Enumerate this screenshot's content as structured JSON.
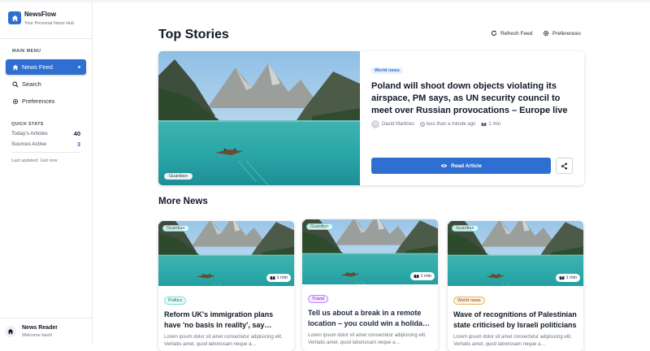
{
  "app": {
    "name": "NewsFlow",
    "tagline": "Your Personal News Hub"
  },
  "sidebar": {
    "menu_label": "MAIN MENU",
    "items": [
      {
        "label": "News Feed",
        "icon": "home-icon",
        "active": true
      },
      {
        "label": "Search",
        "icon": "search-icon",
        "active": false
      },
      {
        "label": "Preferences",
        "icon": "gear-icon",
        "active": false
      }
    ],
    "stats_label": "QUICK STATS",
    "stats": [
      {
        "label": "Today's Articles",
        "value": "40"
      },
      {
        "label": "Sources Active",
        "value": "3"
      }
    ],
    "updated": "Last updated: Just now",
    "user": {
      "name": "News Reader",
      "subtitle": "Welcome back!"
    }
  },
  "header": {
    "title": "Top Stories",
    "refresh_label": "Refresh Feed",
    "preferences_label": "Preferences"
  },
  "featured": {
    "source": "Guardian",
    "category": "World news",
    "title": "Poland will shoot down objects violating its airspace, PM says, as UN security council to meet over Russian provocations – Europe live",
    "author_initial": "D",
    "author": "David Martinez",
    "time": "less than a minute ago",
    "read_time": "1 min",
    "read_button": "Read Article"
  },
  "more_news": {
    "title": "More News",
    "cards": [
      {
        "source": "Guardian",
        "read_time": "1 min",
        "category": "Politics",
        "title": "Reform UK's immigration plans have 'no basis in reality', say…",
        "excerpt": "Lorem ipsum dolor sit amet consectetur adipisicing elit. Veritatis amet, quod laboriosam neque a…"
      },
      {
        "source": "Guardian",
        "read_time": "1 min",
        "category": "Travel",
        "title": "Tell us about a break in a remote location – you could win a holida…",
        "excerpt": "Lorem ipsum dolor sit amet consectetur adipisicing elit. Veritatis amet, quod laboriosam neque a…"
      },
      {
        "source": "Guardian",
        "read_time": "1 min",
        "category": "World news",
        "title": "Wave of recognitions of Palestinian state criticised by Israeli politicians",
        "excerpt": "Lorem ipsum dolor sit amet consectetur adipisicing elit. Veritatis amet, quod laboriosam neque a…"
      }
    ]
  },
  "colors": {
    "accent": "#2f6fd2",
    "text": "#111827",
    "muted": "#6b7280"
  }
}
